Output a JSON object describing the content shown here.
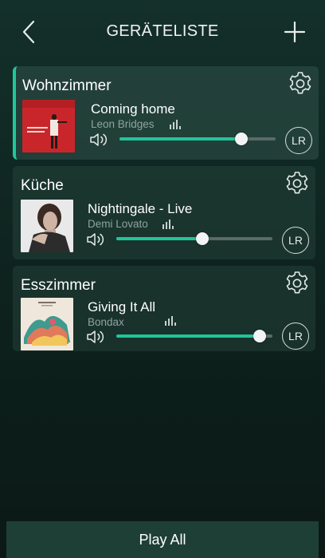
{
  "header": {
    "title": "GERÄTELISTE"
  },
  "devices": [
    {
      "room": "Wohnzimmer",
      "song": "Coming home",
      "artist": "Leon Bridges",
      "volume": 0.78,
      "channel": "LR",
      "active": true
    },
    {
      "room": "Küche",
      "song": "Nightingale - Live",
      "artist": "Demi Lovato",
      "volume": 0.55,
      "channel": "LR",
      "active": false
    },
    {
      "room": "Esszimmer",
      "song": "Giving It All",
      "artist": "Bondax",
      "volume": 0.92,
      "channel": "LR",
      "active": false
    }
  ],
  "footer": {
    "play_all_label": "Play All"
  },
  "colors": {
    "accent": "#20c59a",
    "background": "#0f241f",
    "footer": "#1e3f36"
  },
  "icons": [
    "back-chevron-icon",
    "plus-icon",
    "gear-icon",
    "speaker-icon",
    "equalizer-bars-icon"
  ]
}
